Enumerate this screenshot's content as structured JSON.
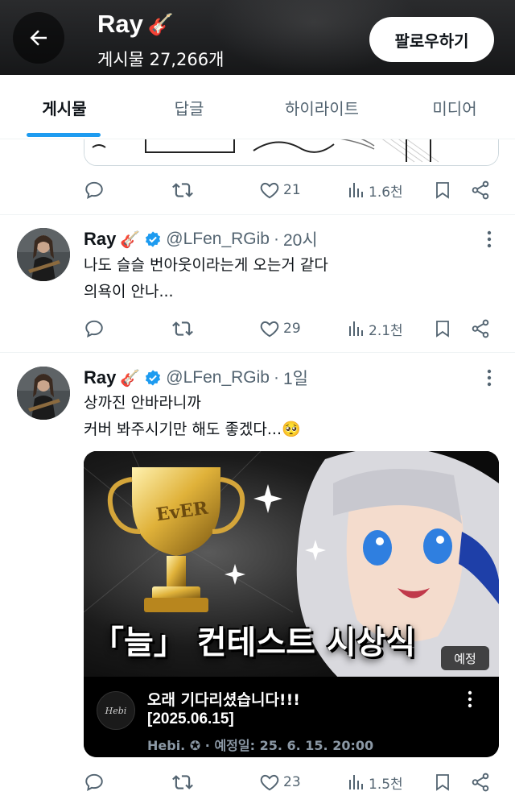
{
  "header": {
    "title": "Ray",
    "title_emoji": "🎸",
    "post_count": "게시물 27,266개",
    "follow_label": "팔로우하기"
  },
  "tabs": [
    {
      "label": "게시물",
      "active": true
    },
    {
      "label": "답글",
      "active": false
    },
    {
      "label": "하이라이트",
      "active": false
    },
    {
      "label": "미디어",
      "active": false
    }
  ],
  "top_tweet_actions": {
    "likes": "21",
    "views": "1.6천"
  },
  "tweets": [
    {
      "name": "Ray",
      "emoji": "🎸",
      "handle": "@LFen_RGib",
      "time": "20시",
      "lines": [
        "나도 슬슬 번아웃이라는게 오는거 같다",
        "의욕이 안나..."
      ],
      "likes": "29",
      "views": "2.1천"
    },
    {
      "name": "Ray",
      "emoji": "🎸",
      "handle": "@LFen_RGib",
      "time": "1일",
      "lines": [
        "상까진 안바라니까",
        "커버 봐주시기만 해도 좋겠다...🥺"
      ],
      "likes": "23",
      "views": "1.5천",
      "card": {
        "image_text": "「늘」 컨테스트 시상식",
        "trophy_text": "EvER",
        "badge": "예정",
        "logo_text": "Hebi",
        "title": "오래 기다리셨습니다!!!",
        "date_line": "[2025.06.15]",
        "meta": "Hebi. ✪ · 예정일: 25. 6. 15. 20:00"
      }
    }
  ],
  "colors": {
    "accent": "#1d9bf0",
    "text": "#0f1419",
    "muted": "#536471",
    "verified": "#1d9bf0"
  }
}
